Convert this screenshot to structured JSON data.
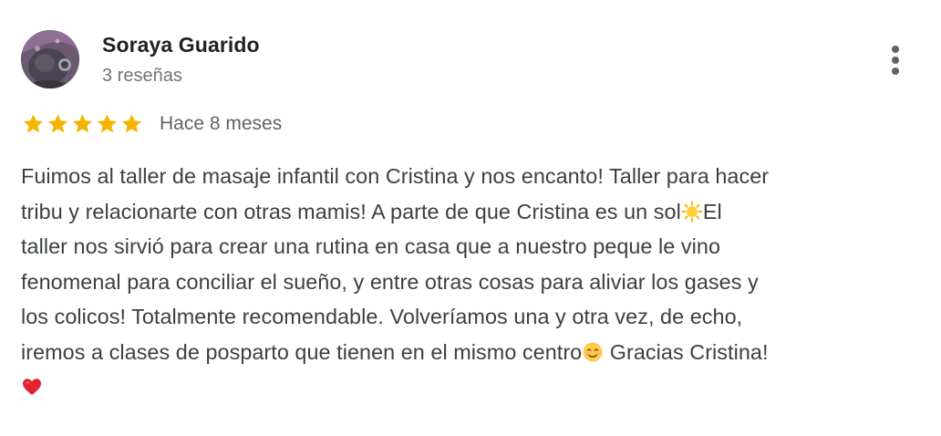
{
  "reviewer": {
    "name": "Soraya Guarido",
    "review_count": "3 reseñas"
  },
  "rating": {
    "stars": 5,
    "max_stars": 5,
    "star_color": "#f4b400",
    "date": "Hace 8 meses"
  },
  "review": {
    "lines": [
      "Fuimos al taller de masaje infantil con Cristina y nos encanto! Taller para hacer",
      "tribu y relacionarte con otras mamis! A parte de que Cristina es un sol",
      "El",
      "taller nos sirvió para crear una rutina en casa que a nuestro peque le vino",
      "fenomenal para conciliar el sueño, y entre otras cosas para aliviar los gases y",
      "los colicos! Totalmente recomendable. Volveríamos una y otra vez, de echo,",
      "iremos a clases de posparto que tienen en el mismo centro",
      " Gracias Cristina!"
    ],
    "emojis": [
      "sun-emoji",
      "smiling-face-emoji",
      "red-heart-emoji"
    ]
  },
  "icons": {
    "more": "more-vertical-icon",
    "star": "star-icon"
  }
}
